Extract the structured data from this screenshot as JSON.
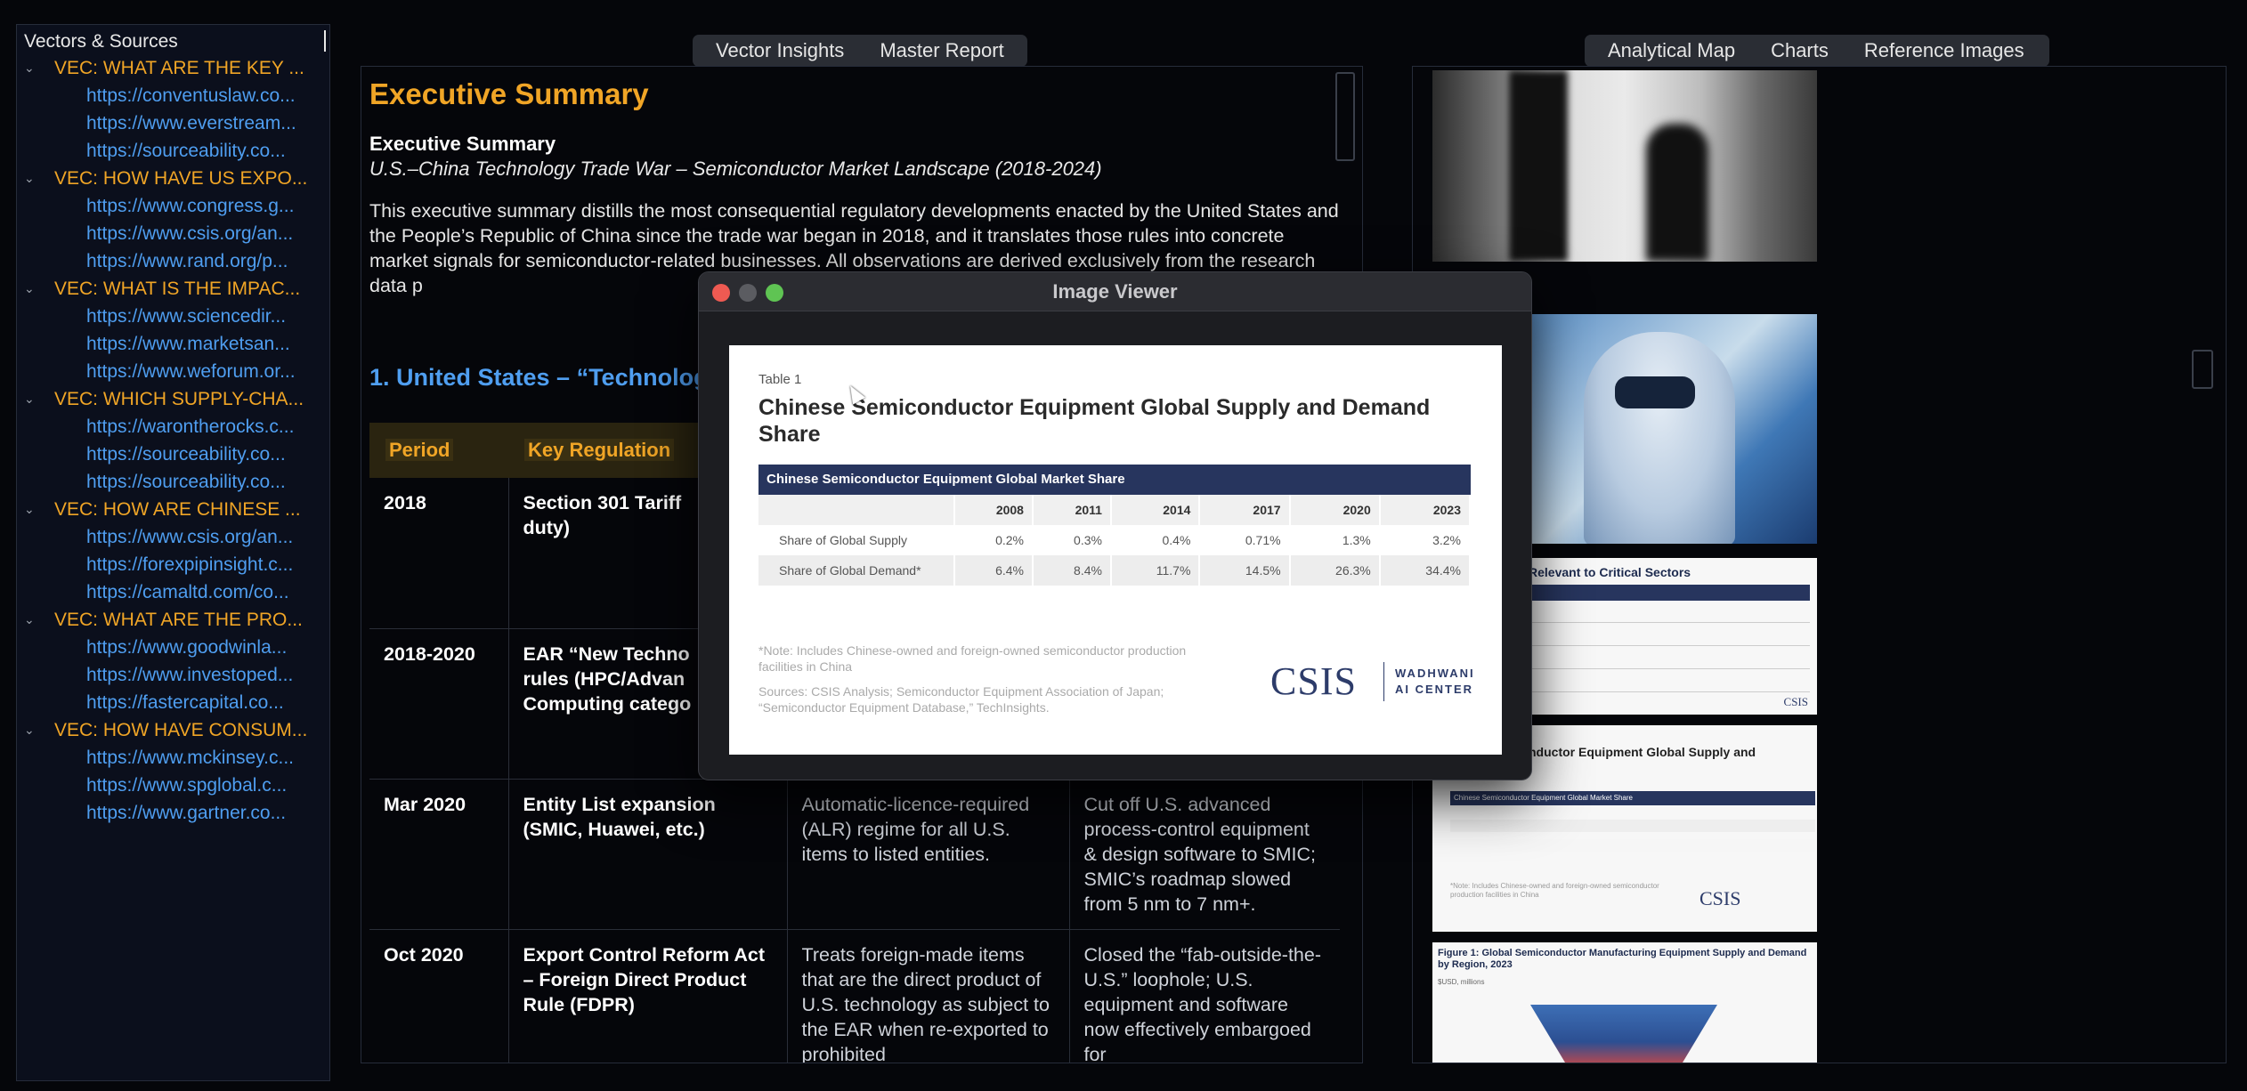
{
  "sidebar": {
    "title": "Vectors & Sources",
    "groups": [
      {
        "label": "VEC: WHAT ARE THE KEY ...",
        "sources": [
          "https://conventuslaw.co...",
          "https://www.everstream...",
          "https://sourceability.co..."
        ]
      },
      {
        "label": "VEC: HOW HAVE US EXPO...",
        "sources": [
          "https://www.congress.g...",
          "https://www.csis.org/an...",
          "https://www.rand.org/p..."
        ]
      },
      {
        "label": "VEC: WHAT IS THE IMPAC...",
        "sources": [
          "https://www.sciencedir...",
          "https://www.marketsan...",
          "https://www.weforum.or..."
        ]
      },
      {
        "label": "VEC: WHICH SUPPLY-CHA...",
        "sources": [
          "https://warontherocks.c...",
          "https://sourceability.co...",
          "https://sourceability.co..."
        ]
      },
      {
        "label": "VEC: HOW ARE CHINESE ...",
        "sources": [
          "https://www.csis.org/an...",
          "https://forexpipinsight.c...",
          "https://camaltd.com/co..."
        ]
      },
      {
        "label": "VEC: WHAT ARE THE PRO...",
        "sources": [
          "https://www.goodwinla...",
          "https://www.investoped...",
          "https://fastercapital.co..."
        ]
      },
      {
        "label": "VEC: HOW HAVE CONSUM...",
        "sources": [
          "https://www.mckinsey.c...",
          "https://www.spglobal.c...",
          "https://www.gartner.co..."
        ]
      }
    ]
  },
  "center_tabs": [
    "Vector Insights",
    "Master Report"
  ],
  "right_tabs": [
    "Analytical Map",
    "Charts",
    "Reference Images"
  ],
  "report": {
    "heading": "Executive Summary",
    "subheading": "Executive Summary",
    "subtitle": "U.S.–China Technology Trade War – Semiconductor Market Landscape (2018-2024)",
    "paragraph": "This executive summary distills the most consequential regulatory developments enacted by the United States and the People’s Republic of China since the trade war began in 2018, and it translates those rules into concrete market signals for semiconductor-related businesses. All observations are derived exclusively from the research data p",
    "section_heading": "1. United States – “Technolog",
    "table": {
      "headers": [
        "Period",
        "Key Regulation",
        "",
        ""
      ],
      "rows": [
        {
          "period": "2018",
          "regulation": "Section 301 Tariff\nduty)",
          "mechanism": "",
          "impact": ""
        },
        {
          "period": "2018-2020",
          "regulation": "EAR “New Techno\nrules (HPC/Advan\nComputing catego",
          "mechanism": "",
          "impact": ""
        },
        {
          "period": "Mar 2020",
          "regulation": "Entity List expansion (SMIC, Huawei, etc.)",
          "mechanism": "Automatic-licence-required (ALR) regime for all U.S. items to listed entities.",
          "impact": "Cut off U.S. advanced process-control equipment & design software to SMIC; SMIC’s roadmap slowed from 5 nm to 7 nm+."
        },
        {
          "period": "Oct 2020",
          "regulation": "Export Control Reform Act – Foreign Direct Product Rule (FDPR)",
          "mechanism": "Treats foreign-made items that are the direct product of U.S. technology as subject to the EAR when re-exported to prohibited",
          "impact": "Closed the “fab-outside-the-U.S.” loophole; U.S. equipment and software now effectively embargoed for"
        }
      ]
    }
  },
  "viewer": {
    "title": "Image Viewer",
    "table_label": "Table 1",
    "doc_title": "Chinese Semiconductor Equipment Global Supply and Demand Share",
    "market_header": "Chinese Semiconductor Equipment Global Market Share",
    "years": [
      "2008",
      "2011",
      "2014",
      "2017",
      "2020",
      "2023"
    ],
    "rows": [
      {
        "label": "Share of Global Supply",
        "values": [
          "0.2%",
          "0.3%",
          "0.4%",
          "0.71%",
          "1.3%",
          "3.2%"
        ]
      },
      {
        "label": "Share of Global Demand*",
        "values": [
          "6.4%",
          "8.4%",
          "11.7%",
          "14.5%",
          "26.3%",
          "34.4%"
        ]
      }
    ],
    "note": "*Note: Includes Chinese-owned and foreign-owned semiconductor production facilities in China",
    "sources": "Sources: CSIS Analysis; Semiconductor Equipment Association of Japan; “Semiconductor Equipment Database,” TechInsights.",
    "logo_main": "CSIS",
    "logo_sub_1": "WADHWANI",
    "logo_sub_2": "AI CENTER"
  },
  "gallery": {
    "sectors_title": "Relevant to Critical Sectors",
    "equip_title": "nductor Equipment Global Supply and",
    "equip_header": "Chinese Semiconductor Equipment Global Market Share",
    "equip_logo": "CSIS",
    "figure_title": "Figure 1: Global Semiconductor Manufacturing Equipment Supply and Demand by Region, 2023",
    "figure_sub": "$USD, millions",
    "sectors_logo": "CSIS"
  }
}
